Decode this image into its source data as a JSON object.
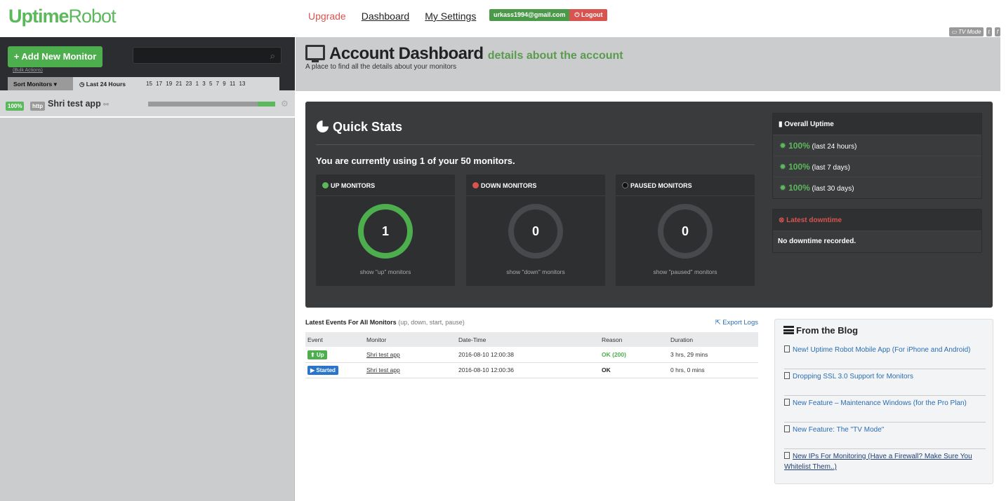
{
  "topbar": {
    "logo_a": "Uptime",
    "logo_b": "Robot",
    "nav": {
      "upgrade": "Upgrade",
      "dashboard": "Dashboard",
      "settings": "My Settings"
    },
    "user_email": "urkass1994@gmail.com",
    "logout": "Logout",
    "tv_mode": "TV Mode"
  },
  "sidebar": {
    "add_monitor": "Add New Monitor",
    "bulk_actions": "(Bulk Actions)",
    "sort_label": "Sort Monitors",
    "time_label": "Last 24 Hours",
    "hours": "15 17 19 21 23 1 3 5 7 9 11 13",
    "monitors": [
      {
        "percent": "100%",
        "type": "http",
        "name": "Shri test app",
        "uptime_bar_fraction": 0.14
      }
    ]
  },
  "header": {
    "title": "Account Dashboard",
    "title_sub": "details about the account",
    "subtitle": "A place to find all the details about your monitors"
  },
  "quick_stats": {
    "title": "Quick Stats",
    "usage": "You are currently using 1 of your 50 monitors.",
    "boxes": [
      {
        "label": "UP MONITORS",
        "count": "1",
        "link": "show \"up\" monitors",
        "color": "#5cb85c"
      },
      {
        "label": "DOWN MONITORS",
        "count": "0",
        "link": "show \"down\" monitors",
        "color": "#d9534f"
      },
      {
        "label": "PAUSED MONITORS",
        "count": "0",
        "link": "show \"paused\" monitors",
        "color": "#111111"
      }
    ]
  },
  "overall_uptime": {
    "title": "Overall Uptime",
    "rows": [
      {
        "value": "100%",
        "period": "(last 24 hours)"
      },
      {
        "value": "100%",
        "period": "(last 7 days)"
      },
      {
        "value": "100%",
        "period": "(last 30 days)"
      }
    ]
  },
  "latest_downtime": {
    "title": "Latest downtime",
    "message": "No downtime recorded."
  },
  "events": {
    "title": "Latest Events For All Monitors",
    "title_sub": "(up, down, start, pause)",
    "export": "Export Logs",
    "columns": [
      "Event",
      "Monitor",
      "Date-Time",
      "Reason",
      "Duration"
    ],
    "rows": [
      {
        "event": "Up",
        "monitor": "Shri test app",
        "datetime": "2016-08-10 12:00:38",
        "reason": "OK (200)",
        "duration": "3 hrs, 29 mins"
      },
      {
        "event": "Started",
        "monitor": "Shri test app",
        "datetime": "2016-08-10 12:00:36",
        "reason": "OK",
        "duration": "0 hrs, 0 mins"
      }
    ]
  },
  "blog": {
    "title": "From the Blog",
    "items": [
      "New! Uptime Robot Mobile App (For iPhone and Android)",
      "Dropping SSL 3.0 Support for Monitors",
      "New Feature – Maintenance Windows (for the Pro Plan)",
      "New Feature: The \"TV Mode\"",
      "New IPs For Monitoring (Have a Firewall? Make Sure You Whitelist Them..)"
    ]
  },
  "colors": {
    "brand": "#5cb85c",
    "danger": "#d9534f",
    "link": "#2a6db1"
  }
}
